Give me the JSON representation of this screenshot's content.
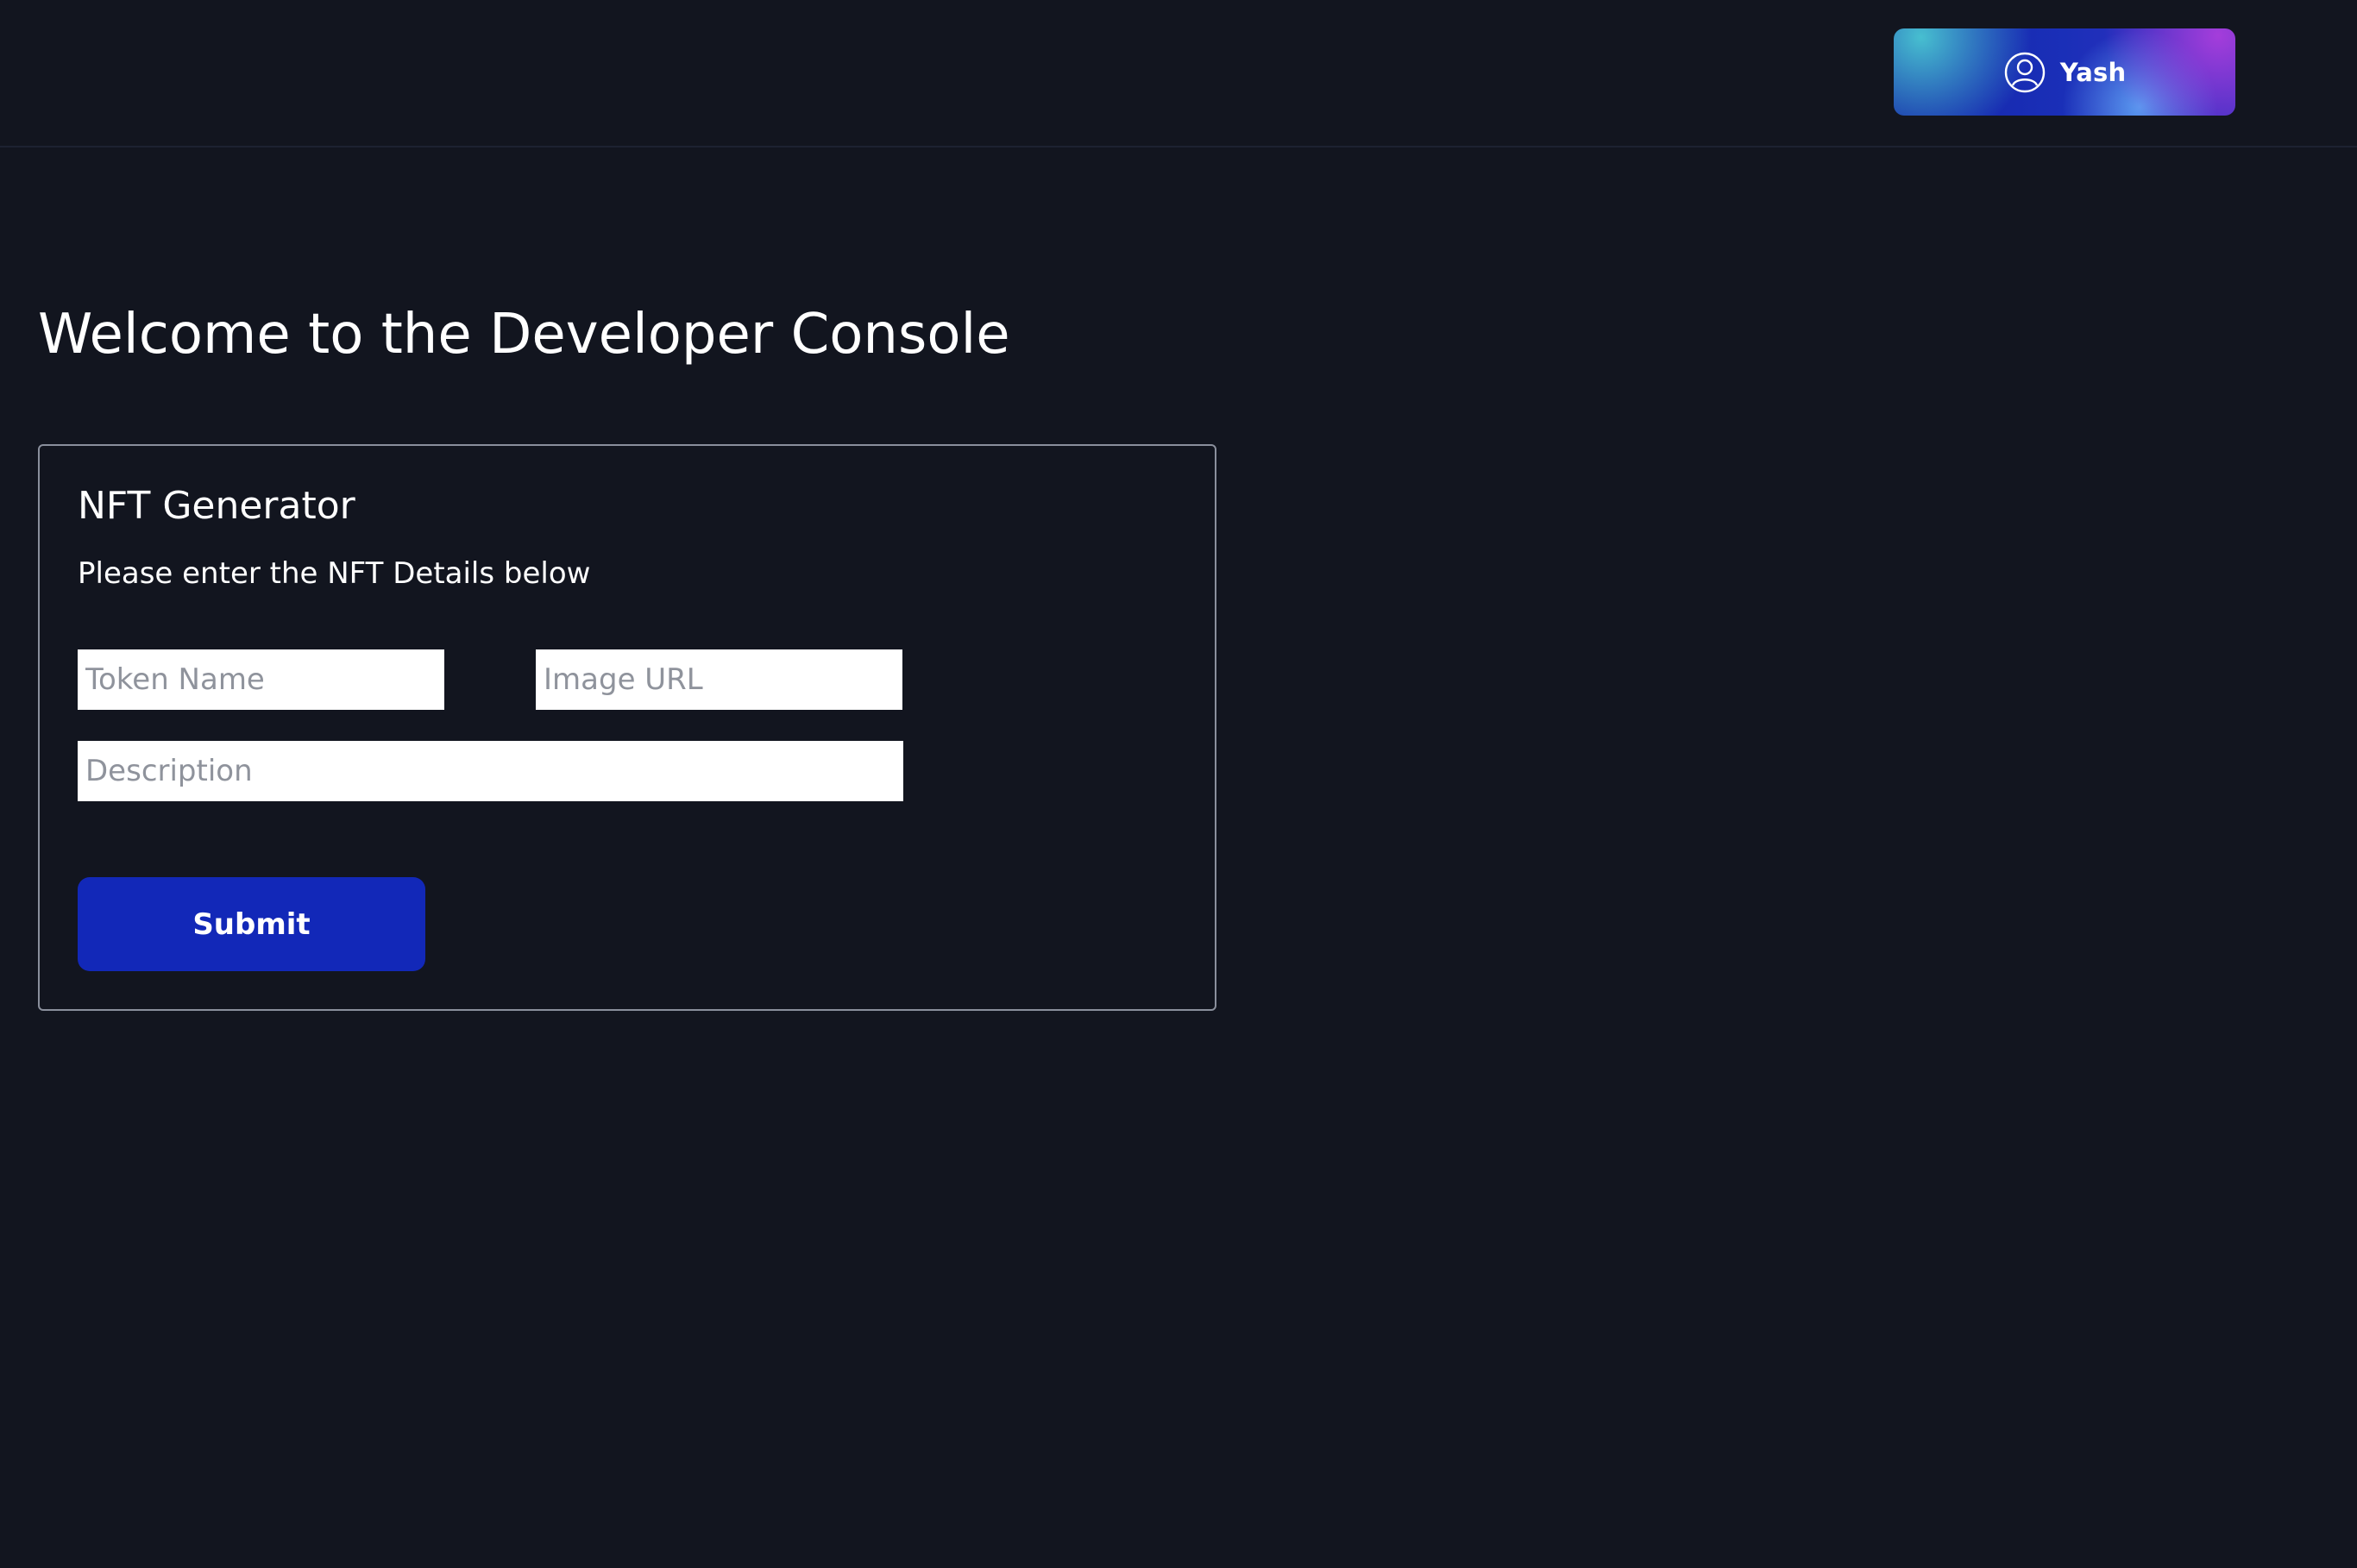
{
  "header": {
    "user": {
      "name": "Yash",
      "icon": "user-circle-icon"
    }
  },
  "page": {
    "title": "Welcome to the Developer Console"
  },
  "nft_form": {
    "title": "NFT Generator",
    "subtitle": "Please enter the NFT Details below",
    "token_name": {
      "placeholder": "Token Name",
      "value": ""
    },
    "image_url": {
      "placeholder": "Image URL",
      "value": ""
    },
    "description": {
      "placeholder": "Description",
      "value": ""
    },
    "submit_label": "Submit"
  },
  "colors": {
    "background": "#12151f",
    "primary_button": "#1228b8",
    "card_border": "#8a8f9c",
    "text": "#ffffff"
  }
}
